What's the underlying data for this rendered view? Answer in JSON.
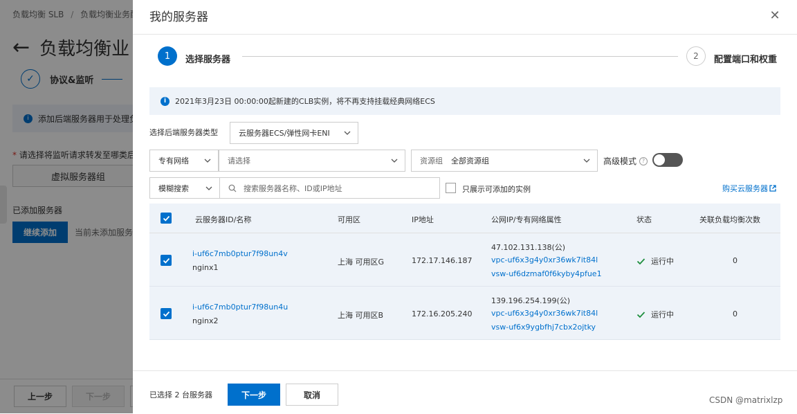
{
  "background": {
    "breadcrumb": [
      "负载均衡 SLB",
      "/",
      "负载均衡业务配"
    ],
    "page_title": "负载均衡业",
    "step1_label": "协议&监听",
    "notice": "添加后端服务器用于处理负",
    "required_label": "请选择将监听请求转发至哪类后",
    "server_group": "虚拟服务器组",
    "added_label": "已添加服务器",
    "continue_btn": "继续添加",
    "none_text": "当前未添加服务",
    "prev_btn": "上一步",
    "next_btn": "下一步"
  },
  "drawer": {
    "title": "我的服务器",
    "close_icon": "close-icon",
    "steps": [
      {
        "num": "1",
        "label": "选择服务器",
        "active": true
      },
      {
        "num": "2",
        "label": "配置端口和权重",
        "active": false
      }
    ],
    "notice": "2021年3月23日 00:00:00起新建的CLB实例，将不再支持挂载经典网络ECS",
    "server_type_label": "选择后端服务器类型",
    "server_type_value": "云服务器ECS/弹性网卡ENI",
    "network_type": "专有网络",
    "vpc_placeholder": "请选择",
    "resource_group_label": "资源组",
    "resource_group_value": "全部资源组",
    "advanced_mode": "高级模式",
    "search_mode": "模糊搜索",
    "search_placeholder": "搜索服务器名称、ID或IP地址",
    "only_addable": "只展示可添加的实例",
    "buy_link": "购买云服务器",
    "table": {
      "headers": [
        "云服务器ID/名称",
        "可用区",
        "IP地址",
        "公网IP/专有网络属性",
        "状态",
        "关联负载均衡次数"
      ],
      "rows": [
        {
          "id": "i-uf6c7mb0ptur7f98un4v",
          "name": "nginx1",
          "zone": "上海 可用区G",
          "ip": "172.17.146.187",
          "public_ip": "47.102.131.138(公)",
          "vpc": "vpc-uf6x3g4y0xr36wk7it84l",
          "vsw": "vsw-uf6dzmaf0f6kyby4pfue1",
          "status": "运行中",
          "count": "0",
          "checked": true
        },
        {
          "id": "i-uf6c7mb0ptur7f98un4u",
          "name": "nginx2",
          "zone": "上海 可用区B",
          "ip": "172.16.205.240",
          "public_ip": "139.196.254.199(公)",
          "vpc": "vpc-uf6x3g4y0xr36wk7it84l",
          "vsw": "vsw-uf6x9ygbfhj7cbx2ojtky",
          "status": "运行中",
          "count": "0",
          "checked": true
        }
      ]
    },
    "footer": {
      "selected_text": "已选择 2 台服务器",
      "next_btn": "下一步",
      "cancel_btn": "取消"
    }
  },
  "watermark": "CSDN @matrixlzp",
  "colors": {
    "primary": "#0070cc",
    "success": "#1e8e3e",
    "notice_bg": "#eef3f9"
  }
}
